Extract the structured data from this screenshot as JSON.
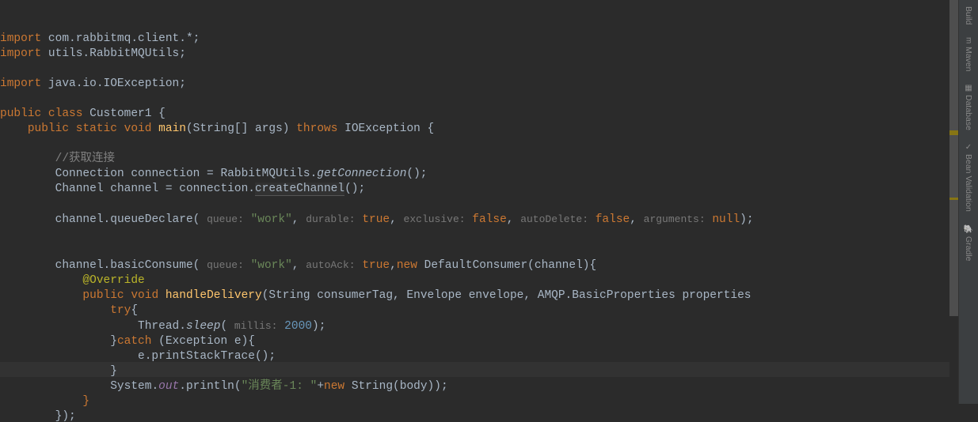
{
  "sidebar": {
    "items": [
      {
        "label": "Build",
        "icon": "🔨"
      },
      {
        "label": "Maven",
        "icon": "m"
      },
      {
        "label": "Database",
        "icon": "▦"
      },
      {
        "label": "Bean Validation",
        "icon": "✓"
      },
      {
        "label": "Gradle",
        "icon": "🐘"
      }
    ]
  },
  "code": {
    "l1": {
      "import": "import",
      "pkg": " com.rabbitmq.client.*;"
    },
    "l2": {
      "import": "import",
      "pkg": " utils.RabbitMQUtils;"
    },
    "l3": "",
    "l4": {
      "import": "import",
      "pkg": " java.io.IOException;"
    },
    "l5": "",
    "l6": {
      "public": "public",
      "class": "class",
      "name": " Customer1 ",
      "brace": "{"
    },
    "l7": {
      "public": "public",
      "static": "static",
      "void": "void",
      "main": "main",
      "params": "(String[] args) ",
      "throws": "throws",
      "exc": " IOException {"
    },
    "l8": "",
    "l9": {
      "comment": "//获取连接"
    },
    "l10": {
      "text1": "Connection connection = RabbitMQUtils.",
      "method": "getConnection",
      "text2": "();"
    },
    "l11": {
      "text1": "Channel channel = connection.",
      "method": "createChannel",
      "text2": "();"
    },
    "l12": "",
    "l13": {
      "text1": "channel.queueDeclare( ",
      "h1": "queue:",
      "s1": " \"work\"",
      "c1": ", ",
      "h2": "durable:",
      "v2": " true",
      "c2": ", ",
      "h3": "exclusive:",
      "v3": " false",
      "c3": ", ",
      "h4": "autoDelete:",
      "v4": " false",
      "c4": ", ",
      "h5": "arguments:",
      "v5": " null",
      "end": ");"
    },
    "l14": "",
    "l15": "",
    "l16": {
      "text1": "channel.basicConsume( ",
      "h1": "queue:",
      "s1": " \"work\"",
      "c1": ", ",
      "h2": "autoAck:",
      "v2": " true",
      "c2": ",",
      "new": "new",
      "rest": " DefaultConsumer(channel){"
    },
    "l17": {
      "anno": "@Override"
    },
    "l18": {
      "public": "public",
      "void": "void",
      "fn": "handleDelivery",
      "params": "(String consumerTag, Envelope envelope, AMQP.BasicProperties properties"
    },
    "l19": {
      "try": "try",
      "brace": "{"
    },
    "l20": {
      "text1": "Thread.",
      "sleep": "sleep",
      "paren": "( ",
      "hint": "millis:",
      "num": " 2000",
      "end": ");"
    },
    "l21": {
      "brace": "}",
      "catch": "catch",
      "text": " (Exception e){"
    },
    "l22": {
      "text": "e.printStackTrace();"
    },
    "l23": {
      "brace": "}"
    },
    "l24": {
      "text1": "System.",
      "out": "out",
      "text2": ".println(",
      "str1": "\"消费者-1: \"",
      "plus": "+",
      "new": "new",
      "text3": " String(body));"
    },
    "l25": {
      "brace": "}"
    },
    "l26": {
      "text": "});"
    }
  }
}
